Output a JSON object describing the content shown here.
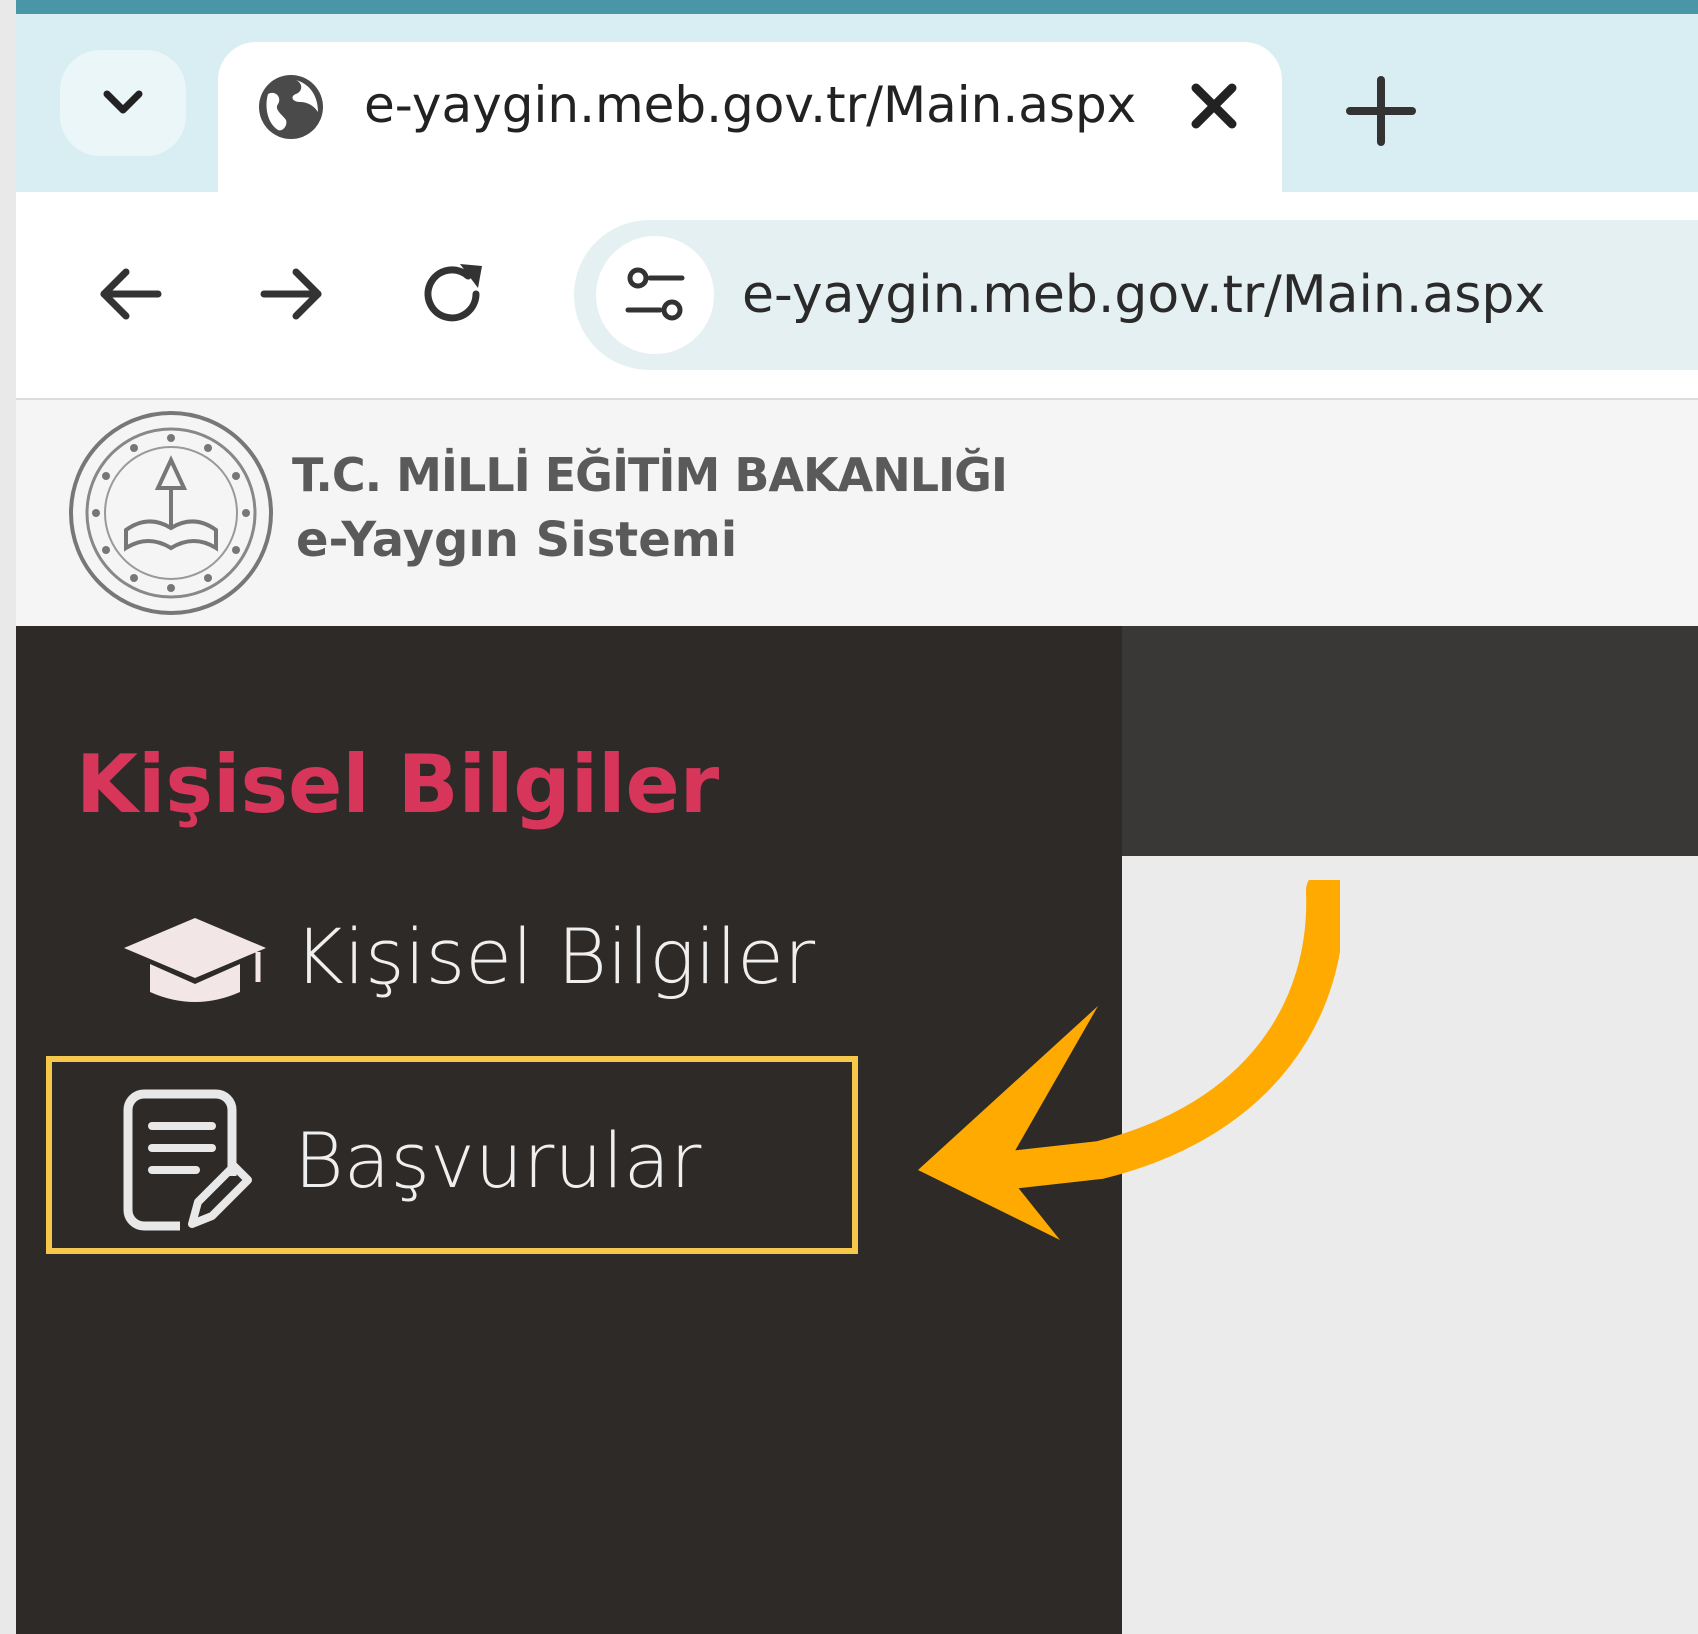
{
  "browser": {
    "tab": {
      "title": "e-yaygin.meb.gov.tr/Main.aspx"
    },
    "address_bar": {
      "url": "e-yaygin.meb.gov.tr/Main.aspx"
    }
  },
  "site": {
    "org_name": "T.C. MİLLİ EĞİTİM BAKANLIĞI",
    "system_name": "e-Yaygın Sistemi"
  },
  "sidebar": {
    "section_title": "Kişisel Bilgiler",
    "items": [
      {
        "label": "Kişisel Bilgiler",
        "icon": "graduation-cap-icon"
      },
      {
        "label": "Başvurular",
        "icon": "document-edit-icon",
        "highlighted": true
      }
    ]
  },
  "colors": {
    "accent_red": "#d7365a",
    "highlight_yellow": "#f5c84b",
    "arrow_orange": "#ffaa00",
    "sidebar_bg": "#2e2a28"
  }
}
